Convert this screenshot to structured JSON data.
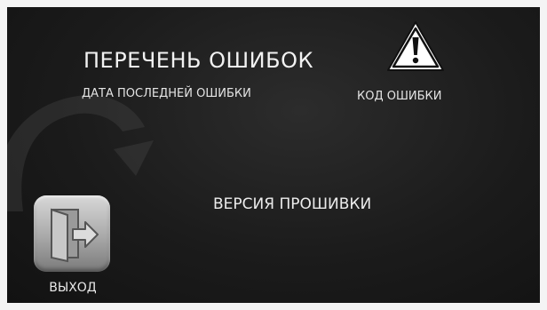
{
  "screen": {
    "title": "ПЕРЕЧЕНЬ ОШИБОК",
    "last_error_date_label": "ДАТА ПОСЛЕДНЕЙ ОШИБКИ",
    "error_code_label": "КОД ОШИБКИ",
    "firmware_version_label": "ВЕРСИЯ ПРОШИВКИ",
    "warning_icon": "warning-triangle-icon"
  },
  "exit_button": {
    "label": "ВЫХОД",
    "icon": "door-exit-icon"
  },
  "colors": {
    "background": "#1b1b1b",
    "text": "#f2f2f2",
    "tile": "#a8a8a8"
  }
}
